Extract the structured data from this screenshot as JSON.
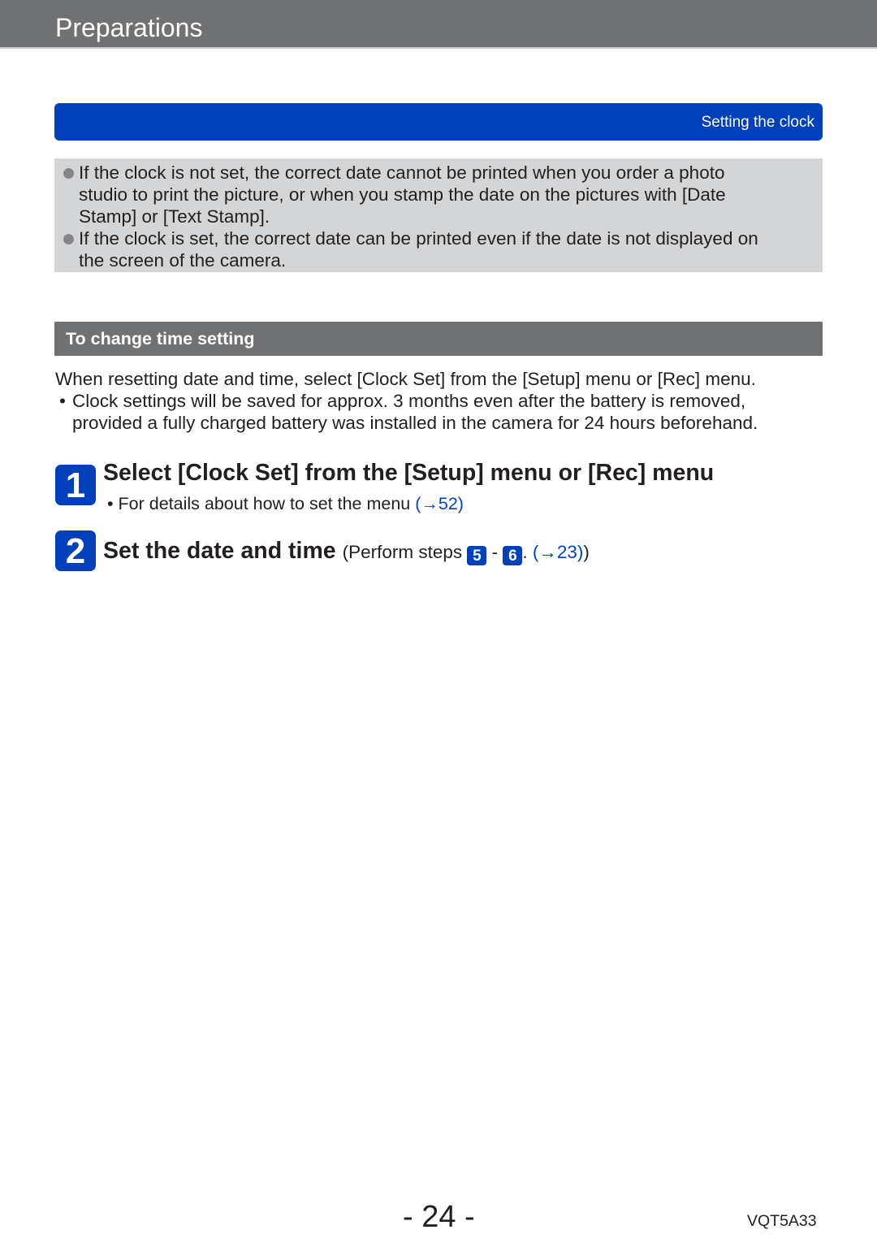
{
  "header": {
    "title": "Preparations"
  },
  "section_tab": {
    "label": "Setting the clock"
  },
  "notes": [
    {
      "lines": [
        "If the clock is not set, the correct date cannot be printed when you order a photo",
        "studio to print the picture, or when you stamp the date on the pictures with [Date",
        "Stamp] or [Text Stamp]."
      ]
    },
    {
      "lines": [
        "If the clock is set, the correct date can be printed even if the date is not displayed on",
        "the screen of the camera."
      ]
    }
  ],
  "subsection": {
    "title": "To change time setting",
    "intro": "When resetting date and time, select [Clock Set] from the [Setup] menu or [Rec] menu.",
    "bullet": "•",
    "detail_lines": [
      "Clock settings will be saved for approx. 3 months even after the battery is removed,",
      "provided a fully charged battery was installed in the camera for 24 hours beforehand."
    ]
  },
  "steps": [
    {
      "number": "1",
      "title": "Select [Clock Set] from the [Setup] menu or [Rec] menu",
      "note_bullet": "•",
      "note": "For details about how to set the menu ",
      "note_link": "(→52)"
    },
    {
      "number": "2",
      "title": "Set the date and time",
      "inline_prefix": "(Perform steps ",
      "step_from": "5",
      "separator": " - ",
      "step_to": "6",
      "period": ". ",
      "link": "(→23)",
      "inline_suffix": ")"
    }
  ],
  "footer": {
    "page_number": "- 24 -",
    "doc_code": "VQT5A33"
  },
  "colors": {
    "header_gray": "#707172",
    "accent_blue": "#0040b8",
    "note_bg": "#d4d5d7",
    "link_blue": "#0043c6"
  }
}
